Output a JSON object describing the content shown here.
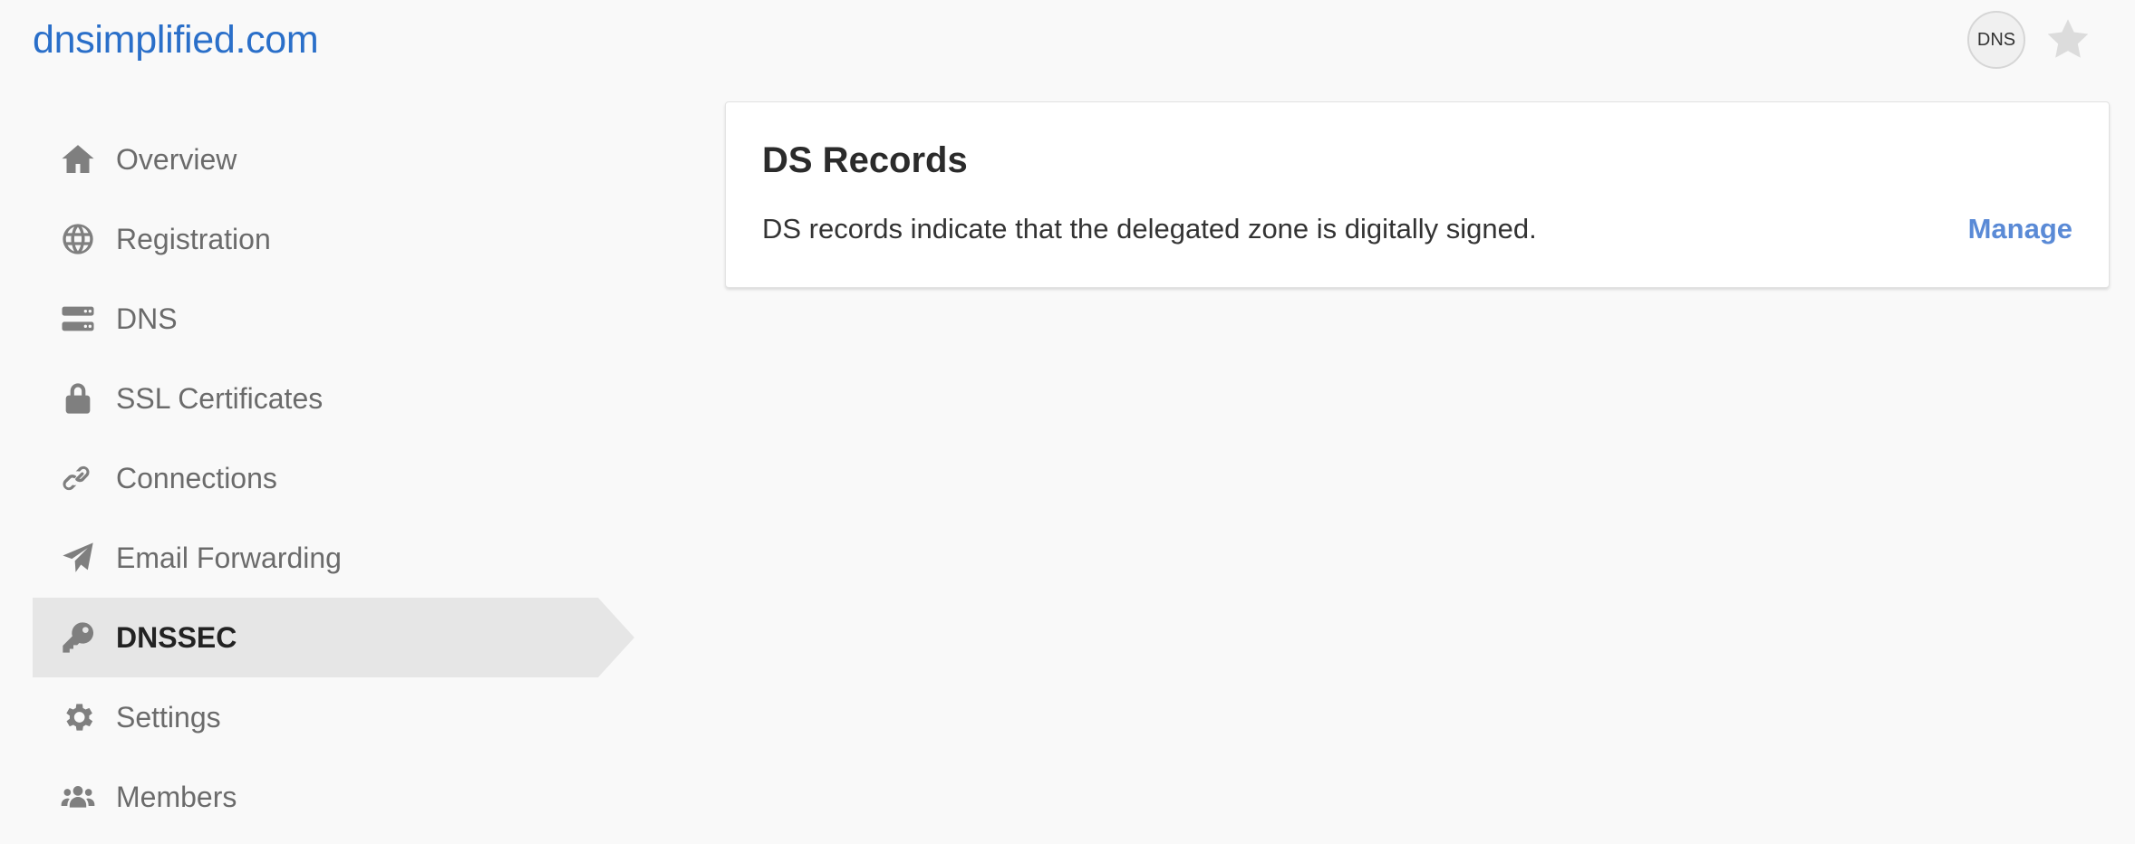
{
  "header": {
    "brand": "dnsimplified.com",
    "badge_label": "DNS",
    "star_icon": "star-icon"
  },
  "sidebar": {
    "items": [
      {
        "label": "Overview",
        "icon": "home-icon"
      },
      {
        "label": "Registration",
        "icon": "globe-icon"
      },
      {
        "label": "DNS",
        "icon": "server-icon"
      },
      {
        "label": "SSL Certificates",
        "icon": "lock-icon"
      },
      {
        "label": "Connections",
        "icon": "link-icon"
      },
      {
        "label": "Email Forwarding",
        "icon": "paper-plane-icon"
      },
      {
        "label": "DNSSEC",
        "icon": "key-icon",
        "active": true
      },
      {
        "label": "Settings",
        "icon": "gear-icon"
      },
      {
        "label": "Members",
        "icon": "users-icon"
      }
    ]
  },
  "main": {
    "card": {
      "title": "DS Records",
      "description": "DS records indicate that the delegated zone is digitally signed.",
      "action_label": "Manage"
    }
  },
  "colors": {
    "brand": "#2a6fc9",
    "link": "#5a8ad6",
    "active_bg": "#e6e6e6",
    "icon": "#7f7f7f"
  }
}
